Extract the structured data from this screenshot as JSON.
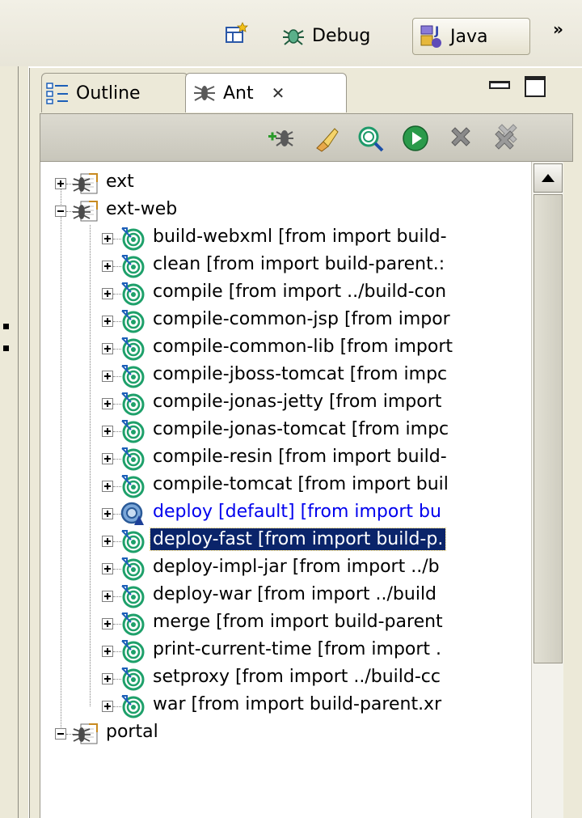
{
  "topbar": {
    "perspectives": [
      {
        "label": "Debug",
        "icon": "bug-icon"
      },
      {
        "label": "Java",
        "icon": "java-perspective-icon",
        "active": true
      }
    ],
    "more": "»"
  },
  "views": {
    "tabs": [
      {
        "label": "Outline",
        "icon": "outline-icon",
        "active": false
      },
      {
        "label": "Ant",
        "icon": "ant-icon",
        "active": true,
        "close": "✕"
      }
    ]
  },
  "toolbar": {
    "buttons": [
      "add-buildfile-icon",
      "hide-internal-targets-icon",
      "search-icon",
      "run-icon",
      "remove-icon",
      "remove-all-icon"
    ]
  },
  "tree": {
    "items": [
      {
        "label": "ext",
        "level": 0,
        "type": "project",
        "expanded": false
      },
      {
        "label": "ext-web",
        "level": 0,
        "type": "project",
        "expanded": true
      },
      {
        "label": "build-webxml [from import build-",
        "level": 1,
        "type": "target"
      },
      {
        "label": "clean [from import build-parent.:",
        "level": 1,
        "type": "target"
      },
      {
        "label": "compile [from import ../build-con",
        "level": 1,
        "type": "target"
      },
      {
        "label": "compile-common-jsp [from impor",
        "level": 1,
        "type": "target"
      },
      {
        "label": "compile-common-lib [from import",
        "level": 1,
        "type": "target"
      },
      {
        "label": "compile-jboss-tomcat [from impc",
        "level": 1,
        "type": "target"
      },
      {
        "label": "compile-jonas-jetty [from import",
        "level": 1,
        "type": "target"
      },
      {
        "label": "compile-jonas-tomcat [from impc",
        "level": 1,
        "type": "target"
      },
      {
        "label": "compile-resin [from import build-",
        "level": 1,
        "type": "target"
      },
      {
        "label": "compile-tomcat [from import buil",
        "level": 1,
        "type": "target"
      },
      {
        "label": "deploy [default] [from import bu",
        "level": 1,
        "type": "default-target"
      },
      {
        "label": "deploy-fast [from import build-p.",
        "level": 1,
        "type": "target",
        "selected": true
      },
      {
        "label": "deploy-impl-jar [from import ../b",
        "level": 1,
        "type": "target"
      },
      {
        "label": "deploy-war [from import ../build",
        "level": 1,
        "type": "target"
      },
      {
        "label": "merge [from import build-parent",
        "level": 1,
        "type": "target"
      },
      {
        "label": "print-current-time [from import .",
        "level": 1,
        "type": "target"
      },
      {
        "label": "setproxy [from import ../build-cc",
        "level": 1,
        "type": "target"
      },
      {
        "label": "war [from import build-parent.xr",
        "level": 1,
        "type": "target"
      },
      {
        "label": "portal",
        "level": 0,
        "type": "project",
        "expanded": true
      }
    ]
  },
  "colors": {
    "selection": "#0a246a",
    "default_target": "#0000ee",
    "chrome": "#ece9d8"
  }
}
